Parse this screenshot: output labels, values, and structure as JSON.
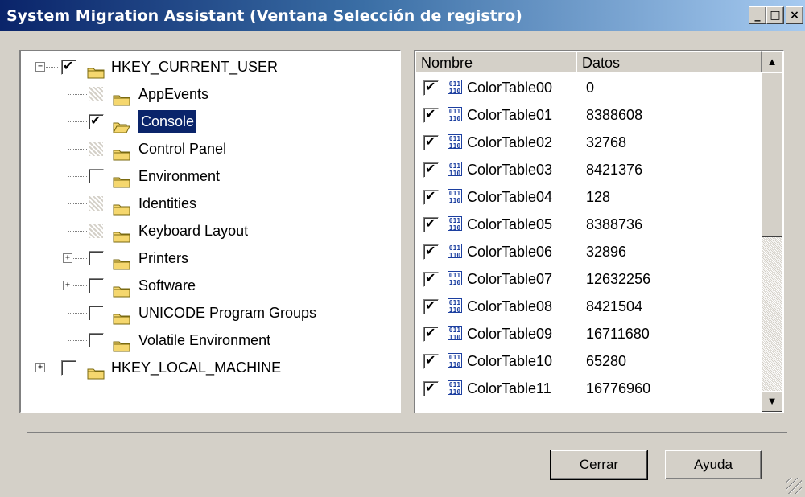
{
  "window": {
    "title": "System Migration Assistant (Ventana Selección de registro)"
  },
  "caption_buttons": {
    "minimize": "_",
    "maximize": "□",
    "close": "×"
  },
  "tree": {
    "nodes": [
      {
        "label": "HKEY_CURRENT_USER",
        "checked": true,
        "expander": "⊟"
      },
      {
        "label": "AppEvents",
        "checked": null
      },
      {
        "label": "Console",
        "checked": true,
        "selected": true
      },
      {
        "label": "Control Panel",
        "checked": null
      },
      {
        "label": "Environment",
        "checked": false
      },
      {
        "label": "Identities",
        "checked": null
      },
      {
        "label": "Keyboard Layout",
        "checked": null
      },
      {
        "label": "Printers",
        "checked": false,
        "expander": "+"
      },
      {
        "label": "Software",
        "checked": false,
        "expander": "+"
      },
      {
        "label": "UNICODE Program Groups",
        "checked": false
      },
      {
        "label": "Volatile Environment",
        "checked": false
      },
      {
        "label": "HKEY_LOCAL_MACHINE",
        "checked": false,
        "expander": "+"
      }
    ]
  },
  "list": {
    "columns": [
      "Nombre",
      "Datos"
    ],
    "rows": [
      {
        "name": "ColorTable00",
        "data": "0"
      },
      {
        "name": "ColorTable01",
        "data": "8388608"
      },
      {
        "name": "ColorTable02",
        "data": "32768"
      },
      {
        "name": "ColorTable03",
        "data": "8421376"
      },
      {
        "name": "ColorTable04",
        "data": "128"
      },
      {
        "name": "ColorTable05",
        "data": "8388736"
      },
      {
        "name": "ColorTable06",
        "data": "32896"
      },
      {
        "name": "ColorTable07",
        "data": "12632256"
      },
      {
        "name": "ColorTable08",
        "data": "8421504"
      },
      {
        "name": "ColorTable09",
        "data": "16711680"
      },
      {
        "name": "ColorTable10",
        "data": "65280"
      },
      {
        "name": "ColorTable11",
        "data": "16776960"
      }
    ],
    "icon_glyph": "011\n110"
  },
  "scrollbar": {
    "up": "▲",
    "down": "▼"
  },
  "buttons": {
    "close": "Cerrar",
    "help": "Ayuda"
  },
  "colors": {
    "title_start": "#0a246a",
    "title_end": "#a6caf0",
    "selection": "#0a246a",
    "folder": "#f5d76e"
  }
}
